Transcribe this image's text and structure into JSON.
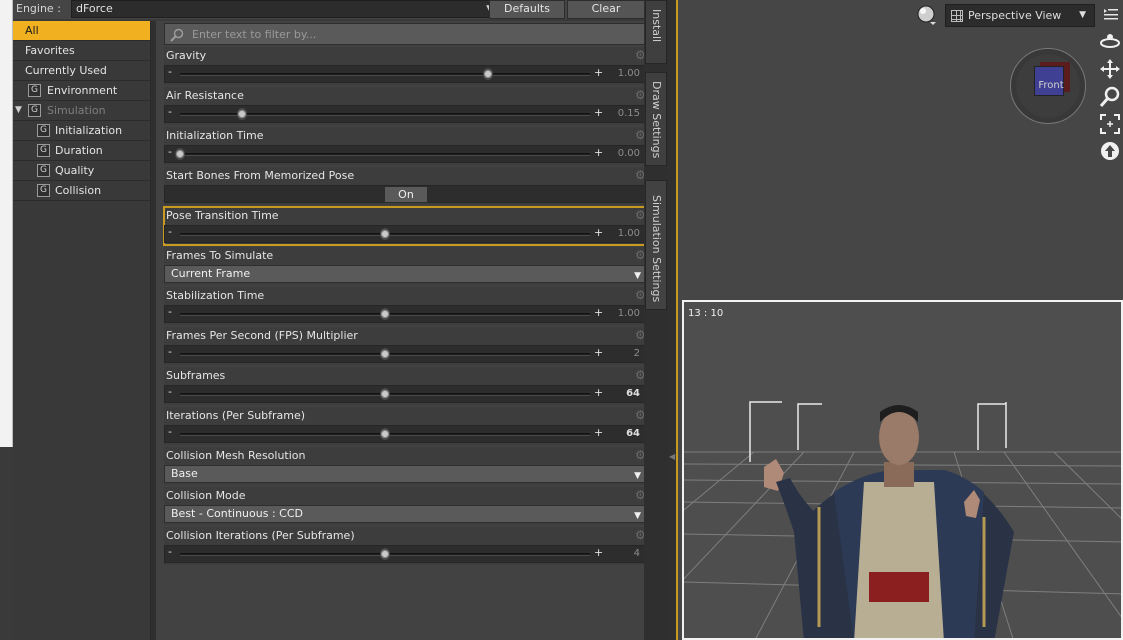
{
  "engine": {
    "label": "Engine :",
    "value": "dForce",
    "defaults_label": "Defaults",
    "clear_label": "Clear"
  },
  "tree": {
    "items": [
      {
        "label": "All"
      },
      {
        "label": "Favorites"
      },
      {
        "label": "Currently Used"
      },
      {
        "label": "Environment",
        "badge": "G"
      },
      {
        "label": "Simulation",
        "badge": "G"
      },
      {
        "label": "Initialization",
        "badge": "G"
      },
      {
        "label": "Duration",
        "badge": "G"
      },
      {
        "label": "Quality",
        "badge": "G"
      },
      {
        "label": "Collision",
        "badge": "G"
      }
    ]
  },
  "filter": {
    "placeholder": "Enter text to filter by..."
  },
  "properties": [
    {
      "name": "Gravity",
      "value": "1.00",
      "level": 0.75
    },
    {
      "name": "Air Resistance",
      "value": "0.15",
      "level": 0.15
    },
    {
      "name": "Initialization Time",
      "value": "0.00",
      "level": 0.0
    },
    {
      "name": "Start Bones From Memorized Pose",
      "toggle": "On"
    },
    {
      "name": "Pose Transition Time",
      "value": "1.00",
      "level": 0.5
    },
    {
      "name": "Frames To Simulate",
      "option": "Current Frame"
    },
    {
      "name": "Stabilization Time",
      "value": "1.00",
      "level": 0.5
    },
    {
      "name": "Frames Per Second (FPS) Multiplier",
      "value": "2",
      "level": 0.5
    },
    {
      "name": "Subframes",
      "value": "64",
      "level": 0.5
    },
    {
      "name": "Iterations (Per Subframe)",
      "value": "64",
      "level": 0.5
    },
    {
      "name": "Collision Mesh Resolution",
      "option": "Base"
    },
    {
      "name": "Collision Mode",
      "option": "Best - Continuous : CCD"
    },
    {
      "name": "Collision Iterations (Per Subframe)",
      "value": "4",
      "level": 0.5
    }
  ],
  "tabs": {
    "install": "Install",
    "draw": "Draw Settings",
    "simulation": "Simulation Settings"
  },
  "viewport": {
    "view": "Perspective View",
    "cube_face": "Front",
    "aspect": "13 : 10"
  },
  "colors": {
    "accent": "#f0b020",
    "highlight_border": "#c89a20"
  }
}
